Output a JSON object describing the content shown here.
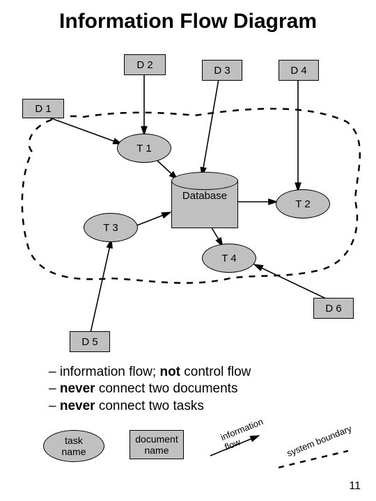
{
  "title": "Information Flow Diagram",
  "nodes": {
    "d1": "D 1",
    "d2": "D 2",
    "d3": "D 3",
    "d4": "D 4",
    "d5": "D 5",
    "d6": "D 6",
    "t1": "T 1",
    "t2": "T 2",
    "t3": "T 3",
    "t4": "T 4",
    "database": "Database"
  },
  "bullets": {
    "b1_pre": "– information flow; ",
    "b1_bold": "not",
    "b1_post": " control flow",
    "b2_pre": "– ",
    "b2_bold": "never",
    "b2_post": " connect two documents",
    "b3_pre": "– ",
    "b3_bold": "never",
    "b3_post": " connect two tasks"
  },
  "legend": {
    "task_line1": "task",
    "task_line2": "name",
    "doc_line1": "document",
    "doc_line2": "name",
    "flow_line1": "information",
    "flow_line2": "flow",
    "boundary": "system boundary"
  },
  "page_number": "11"
}
